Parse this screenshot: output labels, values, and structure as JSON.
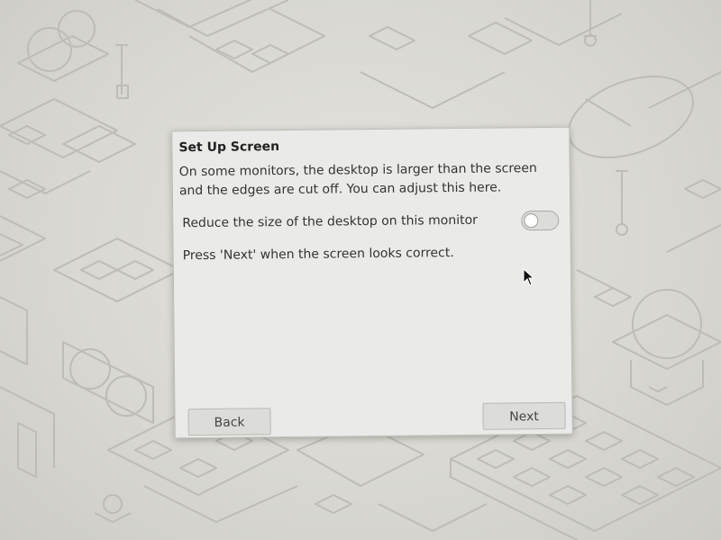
{
  "dialog": {
    "title": "Set Up Screen",
    "description": "On some monitors, the desktop is larger than the screen and the edges are cut off. You can adjust this here.",
    "option": {
      "label": "Reduce the size of the desktop on this monitor",
      "enabled": false
    },
    "instruction": "Press 'Next' when the screen looks correct.",
    "buttons": {
      "back": "Back",
      "next": "Next"
    }
  },
  "icons": {
    "cursor": "mouse-pointer-icon",
    "toggle": "toggle-switch-icon"
  },
  "colors": {
    "dialog_background": "#eaeae8",
    "wallpaper": "#d9d8d2",
    "line_art": "#b9b8b2"
  }
}
